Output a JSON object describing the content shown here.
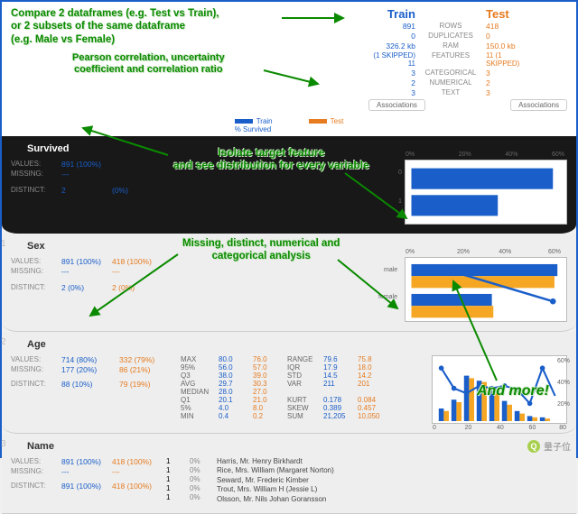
{
  "annotations": {
    "compare": "Compare 2 dataframes (e.g. Test vs Train),\nor 2 subsets of the same dataframe\n(e.g. Male vs Female)",
    "pearson": "Pearson correlation, uncertainty\ncoefficient and correlation ratio",
    "isolate": "Isolate target feature\nand see distribution for every variable",
    "missing": "Missing, distinct, numerical and\ncategorical analysis",
    "more": "And more!"
  },
  "header": {
    "train_title": "Train",
    "test_title": "Test",
    "rows": {
      "label": "ROWS",
      "train": "891",
      "test": "418"
    },
    "dup": {
      "label": "DUPLICATES",
      "train": "0",
      "test": "0"
    },
    "ram": {
      "label": "RAM",
      "train": "326.2 kb",
      "test": "150.0 kb"
    },
    "feat": {
      "label": "FEATURES",
      "train": "(1 SKIPPED) 11",
      "test": "11 (1 SKIPPED)"
    },
    "cat": {
      "label": "CATEGORICAL",
      "train": "3",
      "test": "3"
    },
    "num": {
      "label": "NUMERICAL",
      "train": "2",
      "test": "2"
    },
    "text": {
      "label": "TEXT",
      "train": "3",
      "test": "3"
    },
    "assoc": "Associations"
  },
  "legend": {
    "train": "Train",
    "test": "Test",
    "psurvived": "% Survived"
  },
  "survived": {
    "title": "Survived",
    "values_label": "VALUES:",
    "missing_label": "MISSING:",
    "distinct_label": "DISTINCT:",
    "values": "891 (100%)",
    "missing": "---",
    "distinct": "2",
    "distinct_pct": "(0%)"
  },
  "sex": {
    "title": "Sex",
    "values_label": "VALUES:",
    "missing_label": "MISSING:",
    "distinct_label": "DISTINCT:",
    "train": {
      "values": "891 (100%)",
      "missing": "---",
      "distinct": "2",
      "dpct": "(0%)"
    },
    "test": {
      "values": "418 (100%)",
      "missing": "---",
      "distinct": "2",
      "dpct": "(0%)"
    },
    "cats": {
      "male": "male",
      "female": "female"
    }
  },
  "age": {
    "title": "Age",
    "labels": {
      "values": "VALUES:",
      "missing": "MISSING:",
      "distinct": "DISTINCT:"
    },
    "train": {
      "values": "714  (80%)",
      "missing": "177  (20%)",
      "distinct": "88",
      "dpct": "(10%)"
    },
    "test": {
      "values": "332  (79%)",
      "missing": "86  (21%)",
      "distinct": "79",
      "dpct": "(19%)"
    },
    "stats": {
      "MAX": [
        "80.0",
        "76.0"
      ],
      "95%": [
        "56.0",
        "57.0"
      ],
      "Q3": [
        "38.0",
        "39.0"
      ],
      "AVG": [
        "29.7",
        "30.3"
      ],
      "MEDIAN": [
        "28.0",
        "27.0"
      ],
      "Q1": [
        "20.1",
        "21.0"
      ],
      "5%": [
        "4.0",
        "8.0"
      ],
      "MIN": [
        "0.4",
        "0.2"
      ],
      "RANGE": [
        "79.6",
        "75.8"
      ],
      "IQR": [
        "17.9",
        "18.0"
      ],
      "STD": [
        "14.5",
        "14.2"
      ],
      "VAR": [
        "211",
        "201"
      ],
      "KURT": [
        "0.178",
        "0.084"
      ],
      "SKEW": [
        "0.389",
        "0.457"
      ],
      "SUM": [
        "21,205",
        "10,050"
      ]
    }
  },
  "name": {
    "title": "Name",
    "labels": {
      "values": "VALUES:",
      "missing": "MISSING:",
      "distinct": "DISTINCT:"
    },
    "train": {
      "values": "891 (100%)",
      "missing": "---",
      "distinct": "891",
      "dpct": "(100%)"
    },
    "test": {
      "values": "418 (100%)",
      "missing": "---",
      "distinct": "418",
      "dpct": "(100%)"
    },
    "counts": [
      "1",
      "1",
      "1",
      "1",
      "1"
    ],
    "pcts": [
      "0%",
      "0%",
      "0%",
      "0%",
      "0%"
    ],
    "samples": [
      "Harris, Mr. Henry Birkhardt",
      "Rice, Mrs. William (Margaret Norton)",
      "Seward, Mr. Frederic Kimber",
      "Trout, Mrs. William H (Jessie L)",
      "Olsson, Mr. Nils Johan Goransson"
    ]
  },
  "chart_data": [
    {
      "type": "bar",
      "feature": "Survived",
      "orientation": "h",
      "xlabel": "%",
      "categories": [
        "0",
        "1"
      ],
      "series": [
        {
          "name": "Train",
          "values": [
            62,
            38
          ]
        }
      ],
      "xlim": [
        0,
        60
      ],
      "ticks": [
        "0%",
        "20%",
        "40%",
        "60%"
      ]
    },
    {
      "type": "bar",
      "feature": "Sex",
      "orientation": "h",
      "xlabel": "%",
      "categories": [
        "male",
        "female"
      ],
      "series": [
        {
          "name": "Train",
          "values": [
            65,
            35
          ]
        },
        {
          "name": "Test",
          "values": [
            64,
            36
          ]
        }
      ],
      "overlay_line": {
        "name": "% Survived",
        "values": [
          19,
          74
        ]
      },
      "xlim": [
        0,
        60
      ],
      "ticks": [
        "0%",
        "20%",
        "40%",
        "60%"
      ]
    },
    {
      "type": "bar",
      "feature": "Age",
      "orientation": "v",
      "categories": [
        0,
        10,
        20,
        30,
        40,
        50,
        60,
        70,
        80
      ],
      "series": [
        {
          "name": "Train",
          "values": [
            7,
            13,
            28,
            25,
            18,
            12,
            6,
            3,
            2
          ]
        },
        {
          "name": "Test",
          "values": [
            6,
            11,
            26,
            24,
            16,
            10,
            5,
            2,
            1
          ]
        }
      ],
      "overlay_line": {
        "name": "% Survived",
        "values": [
          59,
          40,
          35,
          42,
          40,
          42,
          39,
          25,
          30
        ]
      },
      "ylim": [
        0,
        60
      ],
      "ticks": [
        "20%",
        "40%",
        "60%"
      ]
    }
  ],
  "footer": "量子位"
}
